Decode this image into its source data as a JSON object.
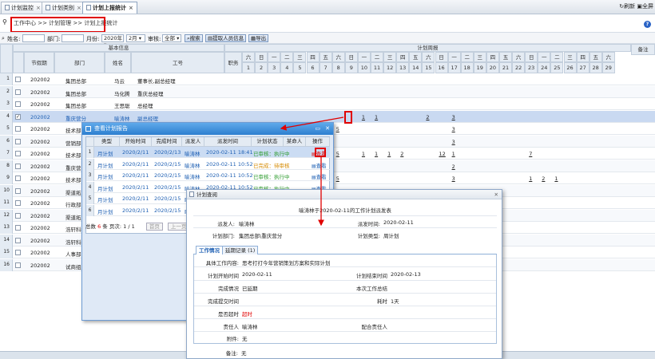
{
  "tabs": [
    {
      "label": "计划监控"
    },
    {
      "label": "计划类别"
    },
    {
      "label": "计划上报统计"
    }
  ],
  "tab_right": {
    "refresh": "刷新",
    "fullscreen": "全屏"
  },
  "breadcrumb": "工作中心 >> 计划管理 >> 计划上报统计",
  "filter": {
    "name_label": "姓名:",
    "dept_label": "部门:",
    "month_label": "月份:",
    "year": "2020年",
    "month": "2月",
    "review_label": "审核:",
    "review_value": "全部",
    "search": "搜索",
    "fetch": "提取人员信息",
    "export": "导出"
  },
  "grid": {
    "group_basic": "基本信息",
    "group_calendar": "计划周报",
    "note": "备注",
    "headers": {
      "code": "节假期",
      "dept": "部门",
      "name": "姓名",
      "workno": "工号",
      "duty": "职务"
    },
    "weekdays": [
      "六",
      "日",
      "一",
      "二",
      "三",
      "四",
      "五",
      "六",
      "日",
      "一",
      "二",
      "三",
      "四",
      "五",
      "六",
      "日",
      "一",
      "二",
      "三",
      "四",
      "五",
      "六",
      "日",
      "一",
      "二",
      "三",
      "四",
      "五",
      "六"
    ],
    "days": [
      "1",
      "2",
      "3",
      "4",
      "5",
      "6",
      "7",
      "8",
      "9",
      "10",
      "11",
      "12",
      "13",
      "14",
      "15",
      "16",
      "17",
      "18",
      "19",
      "20",
      "21",
      "22",
      "23",
      "24",
      "25",
      "26",
      "27",
      "28",
      "29"
    ],
    "rows": [
      {
        "no": "1",
        "code": "202002",
        "dept": "集团总部",
        "name": "马云",
        "workno": "董事长,副总经理",
        "checked": false,
        "marks": []
      },
      {
        "no": "2",
        "code": "202002",
        "dept": "集团总部",
        "name": "马化腾",
        "workno": "重庆总经理",
        "checked": false,
        "marks": []
      },
      {
        "no": "3",
        "code": "202002",
        "dept": "集团总部",
        "name": "王思聪",
        "workno": "总经理",
        "checked": false,
        "marks": []
      },
      {
        "no": "4",
        "code": "202002",
        "dept": "重庆营分",
        "name": "喻涛林",
        "workno": "副总经理",
        "checked": true,
        "marks": [
          {
            "d": 10,
            "v": "1"
          },
          {
            "d": 11,
            "v": "1"
          },
          {
            "d": 15,
            "v": "2"
          },
          {
            "d": 17,
            "v": "3"
          }
        ]
      },
      {
        "no": "5",
        "code": "202002",
        "dept": "技术部",
        "name": "",
        "workno": "",
        "checked": false,
        "marks": [
          {
            "d": 8,
            "v": "5"
          },
          {
            "d": 17,
            "v": "3"
          }
        ]
      },
      {
        "no": "6",
        "code": "202002",
        "dept": "营销部",
        "name": "",
        "workno": "",
        "checked": false,
        "marks": [
          {
            "d": 17,
            "v": "3"
          }
        ]
      },
      {
        "no": "7",
        "code": "202002",
        "dept": "技术部",
        "name": "",
        "workno": "",
        "checked": false,
        "marks": [
          {
            "d": 8,
            "v": "5"
          },
          {
            "d": 10,
            "v": "1"
          },
          {
            "d": 11,
            "v": "1"
          },
          {
            "d": 12,
            "v": "1"
          },
          {
            "d": 13,
            "v": "2"
          },
          {
            "d": 16,
            "v": "12"
          },
          {
            "d": 17,
            "v": "1"
          },
          {
            "d": 23,
            "v": "7"
          }
        ]
      },
      {
        "no": "8",
        "code": "202002",
        "dept": "重庆营分",
        "name": "",
        "workno": "",
        "checked": false,
        "marks": [
          {
            "d": 17,
            "v": "2"
          }
        ]
      },
      {
        "no": "9",
        "code": "202002",
        "dept": "技术部",
        "name": "",
        "workno": "",
        "checked": false,
        "marks": [
          {
            "d": 8,
            "v": "5"
          },
          {
            "d": 17,
            "v": "3"
          },
          {
            "d": 23,
            "v": "1"
          },
          {
            "d": 24,
            "v": "2"
          },
          {
            "d": 25,
            "v": "1"
          }
        ]
      },
      {
        "no": "10",
        "code": "202002",
        "dept": "渠道拓展部",
        "name": "",
        "workno": "",
        "checked": false,
        "marks": []
      },
      {
        "no": "11",
        "code": "202002",
        "dept": "行政部",
        "name": "",
        "workno": "",
        "checked": false,
        "marks": []
      },
      {
        "no": "12",
        "code": "202002",
        "dept": "渠道拓展部",
        "name": "",
        "workno": "",
        "checked": false,
        "marks": []
      },
      {
        "no": "13",
        "code": "202002",
        "dept": "浩轩科技",
        "name": "",
        "workno": "",
        "checked": false,
        "marks": []
      },
      {
        "no": "14",
        "code": "202002",
        "dept": "浩轩科技",
        "name": "",
        "workno": "",
        "checked": false,
        "marks": []
      },
      {
        "no": "15",
        "code": "202002",
        "dept": "人事部",
        "name": "",
        "workno": "",
        "checked": false,
        "marks": []
      },
      {
        "no": "16",
        "code": "202002",
        "dept": "试商组",
        "name": "",
        "workno": "",
        "checked": false,
        "marks": []
      }
    ]
  },
  "dialog_list": {
    "title": "查看计划报告",
    "headers": [
      "类型",
      "开始时间",
      "完成时间",
      "派发人",
      "派发时间",
      "计划状态",
      "某命人",
      "操作"
    ],
    "rows": [
      {
        "no": "1",
        "type": "月计划",
        "start": "2020/2/11",
        "end": "2020/2/13",
        "sender": "喻涛林",
        "time": "2020-02-11 18:41",
        "status": "已审核：执行中",
        "op": "查看"
      },
      {
        "no": "2",
        "type": "月计划",
        "start": "2020/2/11",
        "end": "2020/2/15",
        "sender": "喻涛林",
        "time": "2020-02-11 10:52",
        "status": "已完成：待审核",
        "op": "查看"
      },
      {
        "no": "3",
        "type": "月计划",
        "start": "2020/2/11",
        "end": "2020/2/15",
        "sender": "喻涛林",
        "time": "2020-02-11 10:52",
        "status": "已审核：执行中",
        "op": "查看"
      },
      {
        "no": "4",
        "type": "月计划",
        "start": "2020/2/11",
        "end": "2020/2/15",
        "sender": "喻涛林",
        "time": "2020-02-11 10:52",
        "status": "已审核：执行中",
        "op": "查看"
      },
      {
        "no": "5",
        "type": "月计划",
        "start": "2020/2/11",
        "end": "2020/2/15",
        "sender": "喻涛林",
        "time": "2020-02-11 10:52",
        "status": "已审核：执行中",
        "op": "查看"
      },
      {
        "no": "6",
        "type": "月计划",
        "start": "2020/2/11",
        "end": "2020/2/15",
        "sender": "喻涛林",
        "time": "2020-02-11 10:52",
        "status": "已审核：执行中",
        "op": "查看"
      }
    ],
    "pager": {
      "prefix": "总数",
      "count": "6",
      "mid": "条 页次:",
      "page": "1 / 1",
      "first": "首页",
      "prev": "上一页"
    }
  },
  "dialog_detail": {
    "title": "计划查阅",
    "heading": "喻涛林于2020-02-11的工作计划派发表",
    "sender_label": "派发人:",
    "sender": "喻涛林",
    "time_label": "派发时间:",
    "time": "2020-02-11",
    "dept_label": "计划部门:",
    "dept": "集团总部\\重庆营分",
    "type_label": "计划类型:",
    "type": "周计划",
    "tab_info": "工作情况",
    "tab_log": "延期记录 (1)",
    "content_label": "具体工作内容:",
    "content": "思考打打今年营销策划方案和实际计划",
    "start_label": "计划开始时间",
    "start": "2020-02-11",
    "end_label": "计划结束时间",
    "end": "2020-02-13",
    "done_label": "完成情况",
    "done": "已延期",
    "summary_label": "本次工作总结",
    "submit_label": "完成提交时间",
    "elapsed_label": "耗时",
    "elapsed": "1天",
    "overdue_label": "是否超时",
    "overdue": "超时",
    "resp_label": "责任人",
    "resp": "喻涛林",
    "assist_label": "配合责任人",
    "attach_label": "附件:",
    "attach": "无",
    "remark_label": "备注:",
    "remark": "无"
  },
  "colors": {
    "red": "#e00000",
    "header": "#e4ebf3",
    "dialog_title": "#2d7fd0",
    "selected_row": "#c9d9f1"
  }
}
